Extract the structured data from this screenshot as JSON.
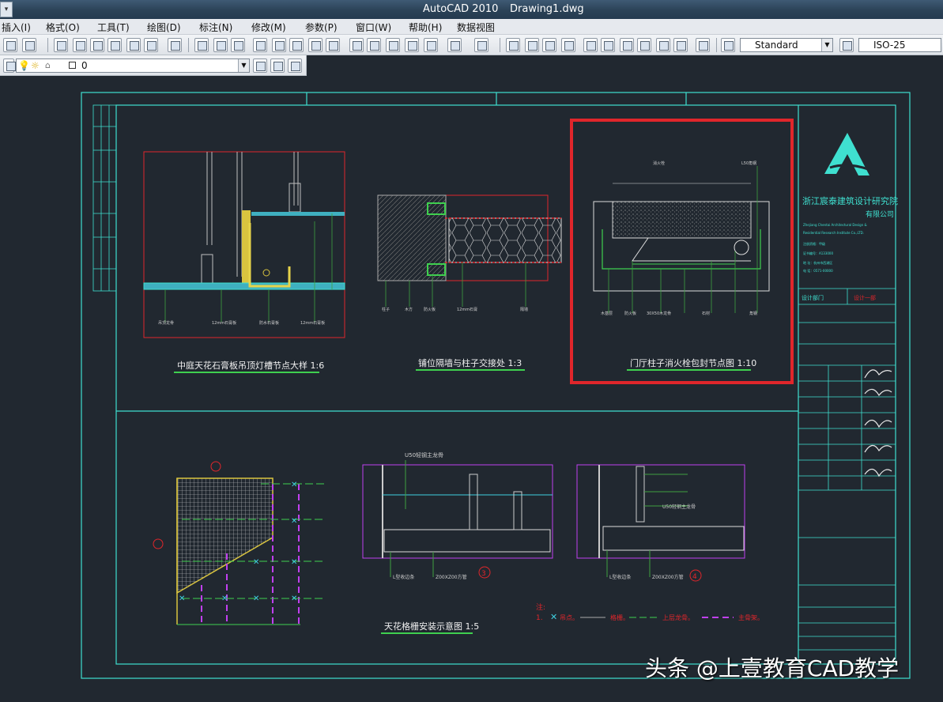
{
  "app": {
    "title": "AutoCAD 2010",
    "file_name": "Drawing1.dwg"
  },
  "menu": [
    "插入(I)",
    "格式(O)",
    "工具(T)",
    "绘图(D)",
    "标注(N)",
    "修改(M)",
    "参数(P)",
    "窗口(W)",
    "帮助(H)",
    "数据视图"
  ],
  "toolbar": {
    "text_style": "Standard",
    "dim_style": "ISO-25",
    "layer": "0"
  },
  "drawing": {
    "titles": {
      "detail1": "中庭天花石膏板吊顶灯槽节点大样 1:6",
      "detail2": "铺位隔墙与柱子交接处 1:3",
      "detail3": "门厅柱子消火栓包封节点图 1:10",
      "detail4": "天花格栅安装示意图 1:5"
    },
    "labels": {
      "u50": "U50轻钢主龙骨",
      "l_keel": "L型收边条",
      "z_grid": "Z00XZ00方管",
      "circle3": "3",
      "circle4": "4"
    },
    "legend": {
      "note": "注:",
      "num": "1.",
      "item1": "吊点。",
      "item2": "格栅。",
      "item3": "上层龙骨。",
      "item4": "主骨架。"
    },
    "title_block": {
      "company": "浙江宸泰建筑设计研究院",
      "company2": "有限公司",
      "rows": [
        "设计部门",
        "设计一部"
      ]
    }
  },
  "watermark": "头条 @上壹教育CAD教学",
  "colors": {
    "highlight": "#e0262b",
    "frame": "#3fe0d0",
    "background": "#212830"
  }
}
